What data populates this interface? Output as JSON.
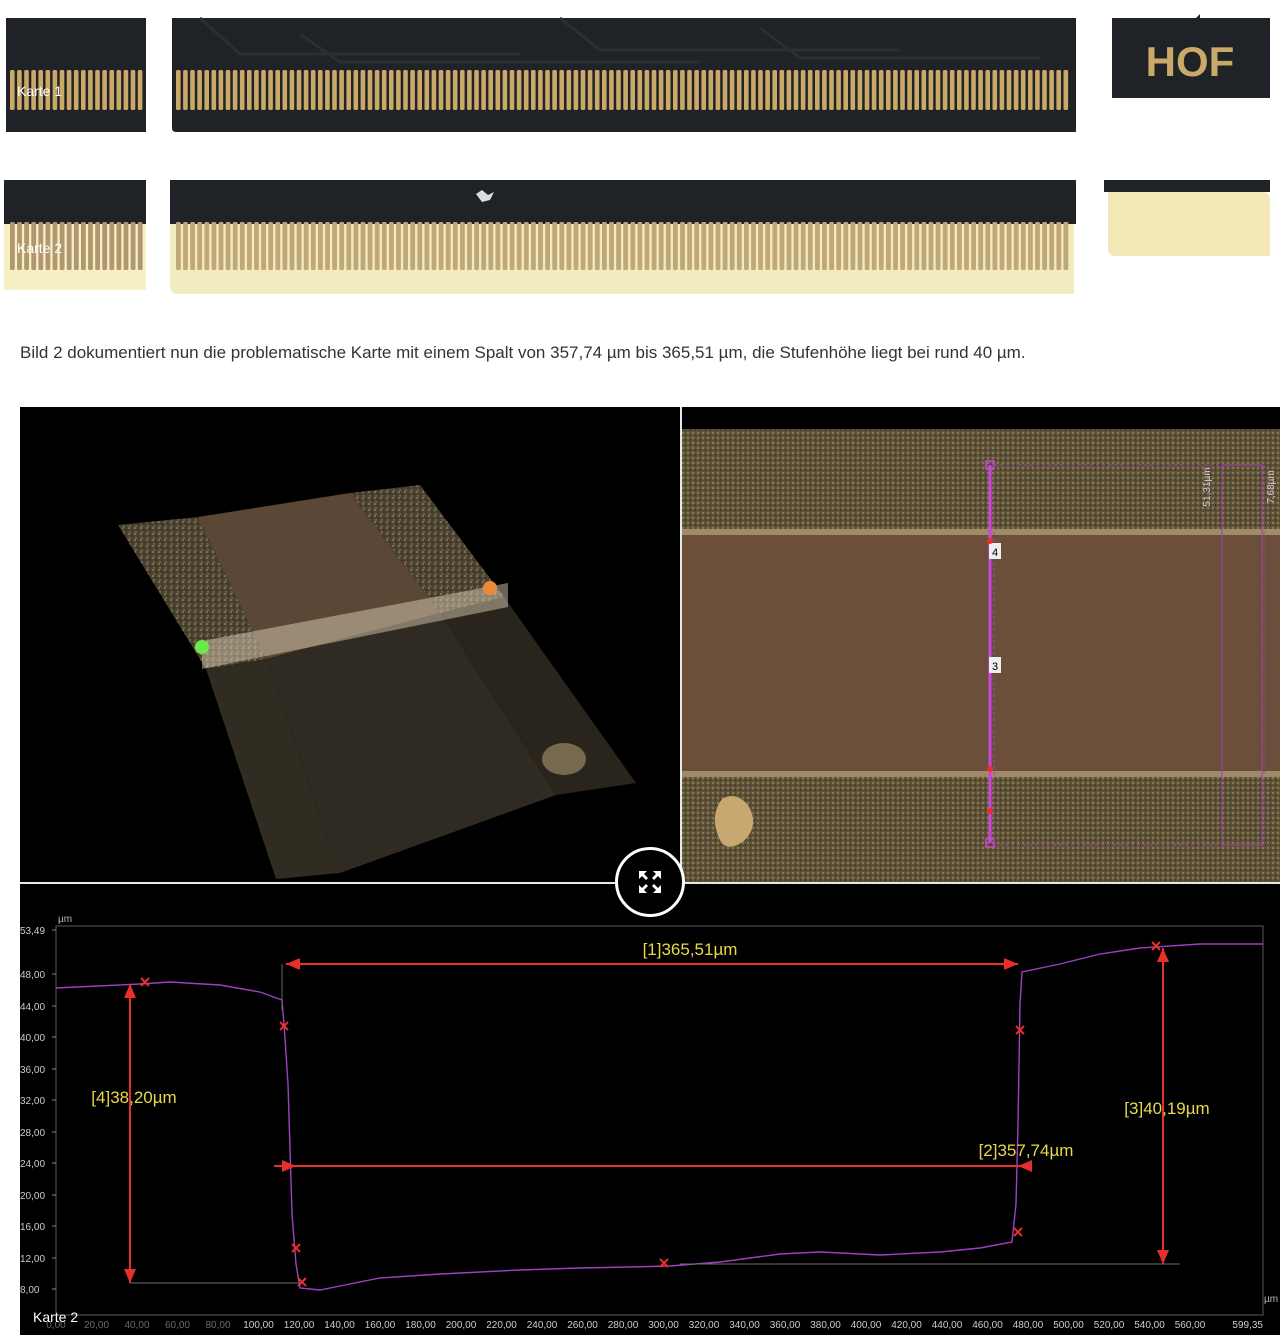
{
  "cards": [
    {
      "label": "Karte 1",
      "logo_text": "HOF"
    },
    {
      "label": "Karte 2"
    }
  ],
  "caption": "Bild 2 dokumentiert nun die problematische Karte mit einem Spalt von 357,74 µm bis 365,51 µm, die Stufenhöhe liegt bei rund 40 µm.",
  "top_view": {
    "markers": [
      "4",
      "3"
    ],
    "side_labels": [
      "51,31µm",
      "7,68µm"
    ]
  },
  "profile": {
    "y_unit": "µm",
    "x_unit": "µm",
    "y_ticks": [
      "53,49",
      "48,00",
      "44,00",
      "40,00",
      "36,00",
      "32,00",
      "28,00",
      "24,00",
      "20,00",
      "16,00",
      "12,00",
      "8,00"
    ],
    "x_ticks": [
      "0,00",
      "20,00",
      "40,00",
      "60,00",
      "80,00",
      "100,00",
      "120,00",
      "140,00",
      "160,00",
      "180,00",
      "200,00",
      "220,00",
      "240,00",
      "260,00",
      "280,00",
      "300,00",
      "320,00",
      "340,00",
      "360,00",
      "380,00",
      "400,00",
      "420,00",
      "440,00",
      "460,00",
      "480,00",
      "500,00",
      "520,00",
      "540,00",
      "560,00",
      "599,35"
    ],
    "measurements": [
      {
        "label": "[1]365,51µm"
      },
      {
        "label": "[2]357,74µm"
      },
      {
        "label": "[3]40,19µm"
      },
      {
        "label": "[4]38,20µm"
      }
    ],
    "overlay_label": "Karte 2"
  },
  "colors": {
    "profile_line": "#a040c0",
    "measure_red": "#e8302a",
    "measure_text": "#e8d84a",
    "gold": "#c9a868",
    "pcb": "#1f2226"
  }
}
